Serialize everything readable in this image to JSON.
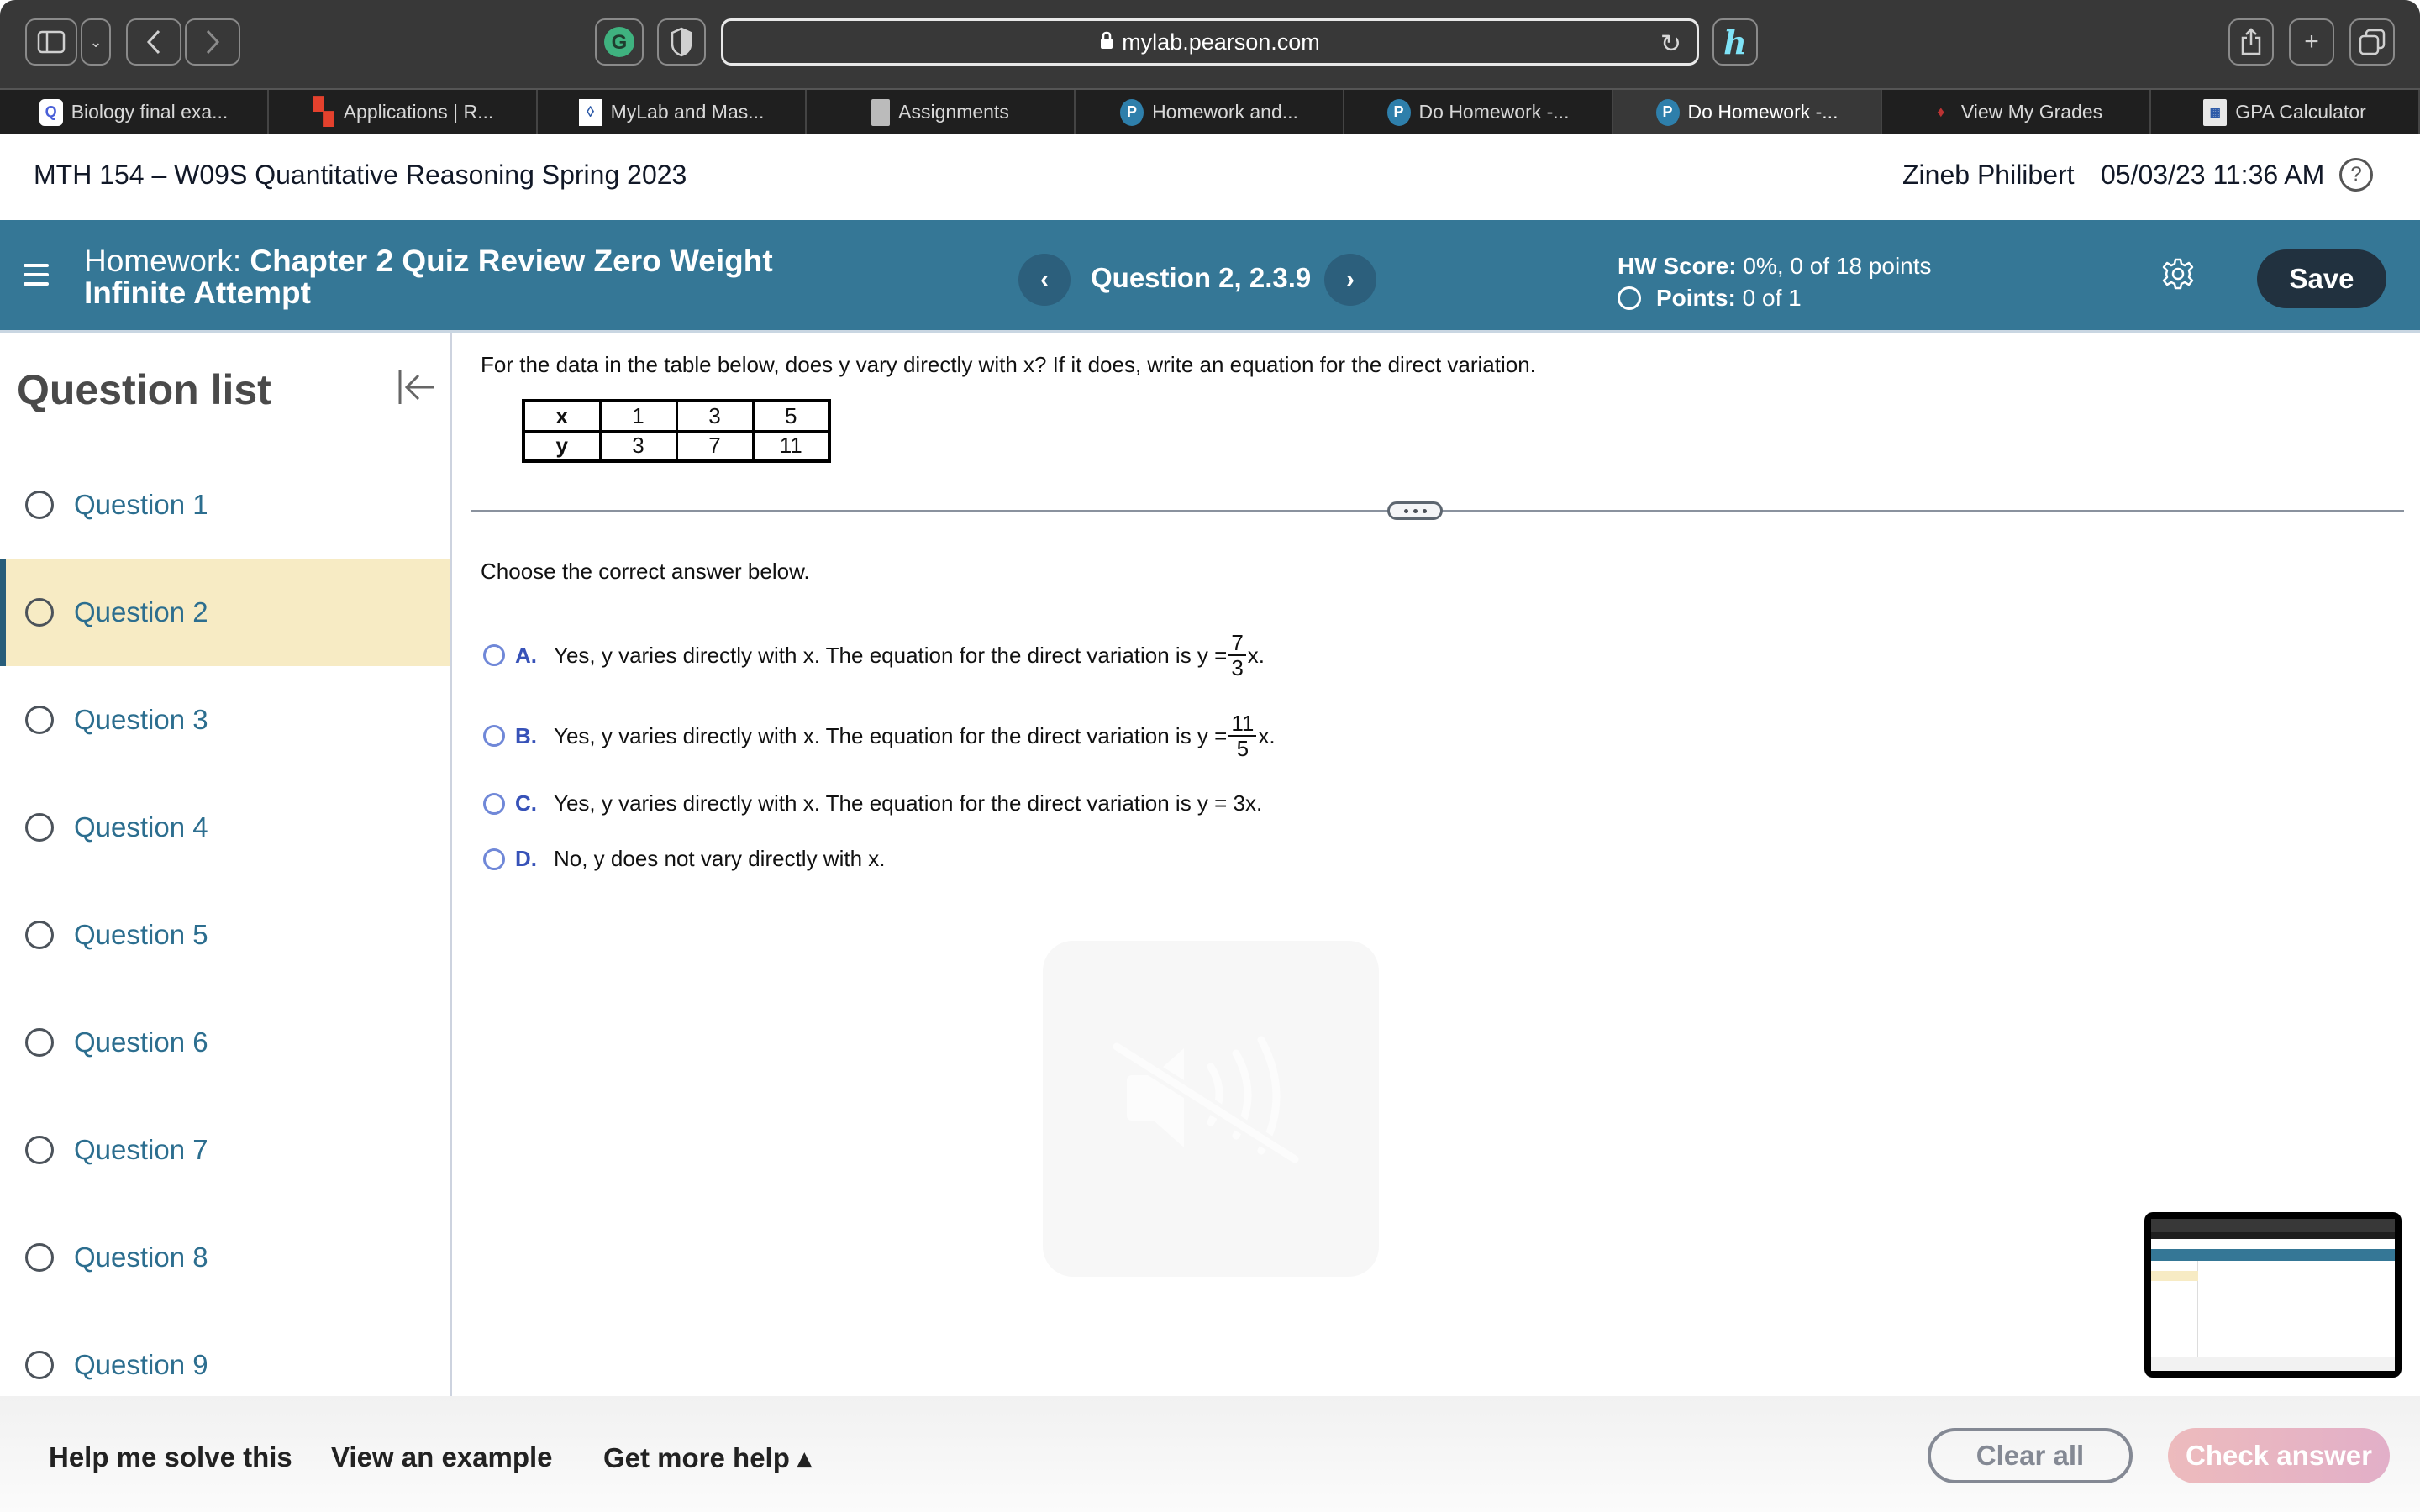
{
  "browser": {
    "url": "mylab.pearson.com",
    "tabs": [
      {
        "label": "Biology final exa...",
        "icon": "quizlet-icon"
      },
      {
        "label": "Applications | R...",
        "icon": "red-logo-icon"
      },
      {
        "label": "MyLab and Mas...",
        "icon": "mylab-icon"
      },
      {
        "label": "Assignments",
        "icon": "document-icon"
      },
      {
        "label": "Homework and...",
        "icon": "pearson-icon"
      },
      {
        "label": "Do Homework -...",
        "icon": "pearson-icon"
      },
      {
        "label": "Do Homework -...",
        "icon": "pearson-icon",
        "active": true
      },
      {
        "label": "View My Grades",
        "icon": "flame-icon"
      },
      {
        "label": "GPA Calculator",
        "icon": "calculator-icon"
      }
    ]
  },
  "course": {
    "title": "MTH 154 – W09S Quantitative Reasoning Spring 2023",
    "user": "Zineb Philibert",
    "datetime": "05/03/23 11:36 AM"
  },
  "homework": {
    "label": "Homework:",
    "name": "Chapter 2 Quiz Review Zero Weight Infinite Attempt",
    "question_label": "Question 2, 2.3.9",
    "hw_score_label": "HW Score:",
    "hw_score_value": "0%, 0 of 18 points",
    "points_label": "Points:",
    "points_value": "0 of 1",
    "save_label": "Save"
  },
  "sidebar": {
    "title": "Question list",
    "items": [
      {
        "label": "Question 1"
      },
      {
        "label": "Question 2",
        "active": true
      },
      {
        "label": "Question 3"
      },
      {
        "label": "Question 4"
      },
      {
        "label": "Question 5"
      },
      {
        "label": "Question 6"
      },
      {
        "label": "Question 7"
      },
      {
        "label": "Question 8"
      },
      {
        "label": "Question 9"
      }
    ]
  },
  "question": {
    "prompt": "For the data in the table below, does y vary directly with x? If it does, write an equation for the direct variation.",
    "table": {
      "rows": [
        {
          "header": "x",
          "values": [
            "1",
            "3",
            "5"
          ]
        },
        {
          "header": "y",
          "values": [
            "3",
            "7",
            "11"
          ]
        }
      ]
    },
    "instruction": "Choose the correct answer below.",
    "options": [
      {
        "letter": "A.",
        "text": "Yes, y varies directly with x. The equation for the direct variation is y =",
        "frac_num": "7",
        "frac_den": "3",
        "suffix": "x."
      },
      {
        "letter": "B.",
        "text": "Yes, y varies directly with x. The equation for the direct variation is y =",
        "frac_num": "11",
        "frac_den": "5",
        "suffix": "x."
      },
      {
        "letter": "C.",
        "text": "Yes, y varies directly with x. The equation for the direct variation is y = 3x."
      },
      {
        "letter": "D.",
        "text": "No, y does not vary directly with x."
      }
    ]
  },
  "footer": {
    "help_me_solve": "Help me solve this",
    "view_example": "View an example",
    "get_more_help": "Get more help ▴",
    "clear_all": "Clear all",
    "check_answer": "Check answer"
  },
  "colors": {
    "brand_bar": "#357796",
    "active_question_bg": "#f7ebc4",
    "link_blue": "#2c6e8f",
    "option_letter": "#3752b8",
    "save_button": "#21313f"
  }
}
